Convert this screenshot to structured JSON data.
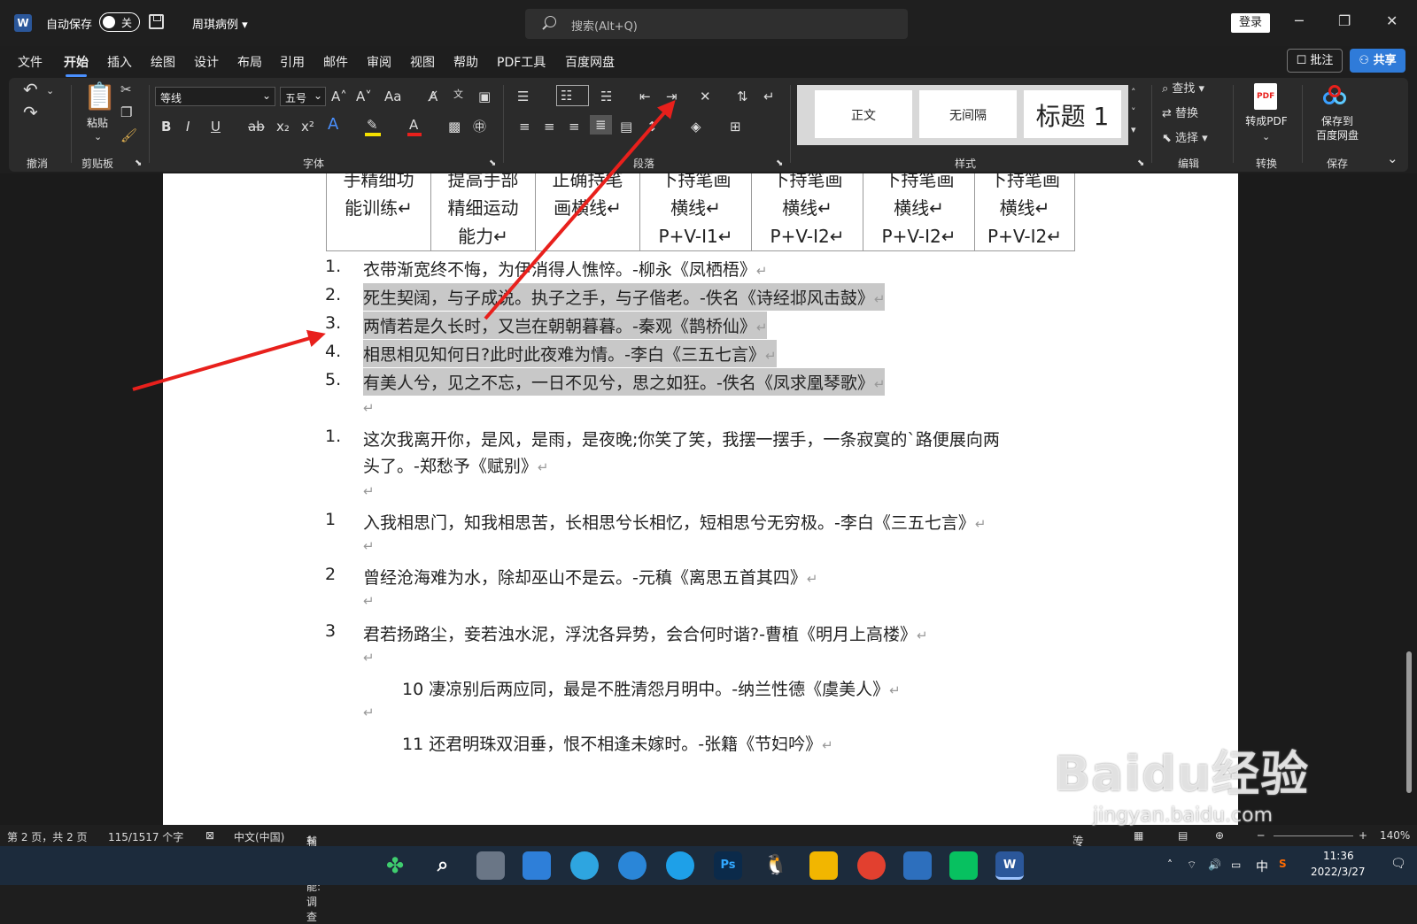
{
  "titlebar": {
    "app_icon": "W",
    "autosave_label": "自动保存",
    "autosave_state": "关",
    "doc_title": "周琪病例 ▾",
    "search_placeholder": "搜索(Alt+Q)",
    "login": "登录",
    "min": "─",
    "max": "❐",
    "close": "✕"
  },
  "tabs": [
    "文件",
    "开始",
    "插入",
    "绘图",
    "设计",
    "布局",
    "引用",
    "邮件",
    "审阅",
    "视图",
    "帮助",
    "PDF工具",
    "百度网盘"
  ],
  "actions": {
    "comment": "☐ 批注",
    "share": "⚇ 共享"
  },
  "ribbon": {
    "groups": [
      "撤消",
      "剪贴板",
      "字体",
      "段落",
      "样式",
      "编辑",
      "转换",
      "保存"
    ],
    "paste": "粘贴",
    "font_name": "等线",
    "font_size": "五号",
    "styles": [
      "正文",
      "无间隔",
      "标题 1"
    ],
    "edit": [
      "查找 ▾",
      "替换",
      "选择 ▾"
    ],
    "convert": "转成PDF",
    "save_baidu": [
      "保存到",
      "百度网盘"
    ],
    "font_buttons": [
      "B",
      "I",
      "U",
      "ab",
      "x₂",
      "x²"
    ],
    "grow": "A˄",
    "shrink": "A˅",
    "case": "Aa",
    "collapse": "⌄"
  },
  "table": {
    "cells": [
      [
        "手精细功",
        "能训练↵"
      ],
      [
        "提高手部",
        "精细运动",
        "能力↵"
      ],
      [
        "正确持笔",
        "画横线↵"
      ],
      [
        "下持笔画",
        "横线↵",
        "P+V-I1↵"
      ],
      [
        "下持笔画",
        "横线↵",
        "P+V-I2↵"
      ],
      [
        "下持笔画",
        "横线↵",
        "P+V-I2↵"
      ],
      [
        "下持笔画",
        "横线↵",
        "P+V-I2↵"
      ]
    ]
  },
  "list1": [
    {
      "num": "1.",
      "text": "衣带渐宽终不悔，为伊消得人憔悴。-柳永《凤栖梧》",
      "hl": false
    },
    {
      "num": "2.",
      "text": "死生契阔，与子成说。执子之手，与子偕老。-佚名《诗经邶风击鼓》",
      "hl": true
    },
    {
      "num": "3.",
      "text": "两情若是久长时，又岂在朝朝暮暮。-秦观《鹊桥仙》",
      "hl": true
    },
    {
      "num": "4.",
      "text": "相思相见知何日?此时此夜难为情。-李白《三五七言》",
      "hl": true
    },
    {
      "num": "5.",
      "text": "有美人兮，见之不忘，一日不见兮，思之如狂。-佚名《凤求凰琴歌》",
      "hl": true
    }
  ],
  "para_mark": "↵",
  "list2": {
    "num": "1.",
    "line1": "这次我离开你，是风，是雨，是夜晚;你笑了笑，我摆一摆手，一条寂寞的`路便展向两",
    "line2": "头了。-郑愁予《赋别》"
  },
  "list3": [
    {
      "num": "1",
      "text": "入我相思门，知我相思苦，长相思兮长相忆，短相思兮无穷极。-李白《三五七言》"
    },
    {
      "num": "2",
      "text": "曾经沧海难为水，除却巫山不是云。-元稹《离思五首其四》"
    },
    {
      "num": "3",
      "text": "君若扬路尘，妾若浊水泥，浮沈各异势，会合何时谐?-曹植《明月上高楼》"
    }
  ],
  "indented": [
    "10 凄凉别后两应同，最是不胜清怨月明中。-纳兰性德《虞美人》",
    "11 还君明珠双泪垂，恨不相逢未嫁时。-张籍《节妇吟》"
  ],
  "status": {
    "page": "第 2 页，共 2 页",
    "words": "115/1517 个字",
    "lang": "中文(中国)",
    "access": "辅助功能: 调查",
    "focus": "专注",
    "zoom": "140%"
  },
  "taskbar": {
    "time": "11:36",
    "date": "2022/3/27",
    "ime": "中",
    "ps": "Ps",
    "word": "W"
  },
  "watermark": {
    "brand": "Baidu经验",
    "url": "jingyan.baidu.com"
  },
  "colors": {
    "accent": "#2f7bd9",
    "arrow": "#e8201c",
    "highlight": "#c8c8c8"
  }
}
